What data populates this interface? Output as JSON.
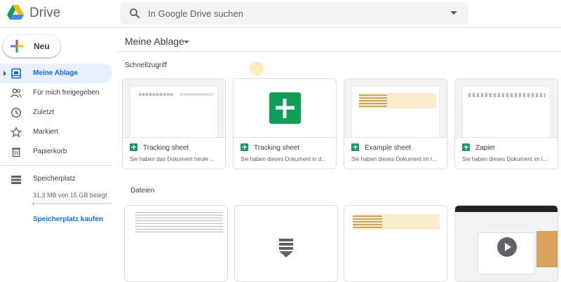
{
  "app": {
    "name": "Drive"
  },
  "search": {
    "placeholder": "In Google Drive suchen"
  },
  "new_button": {
    "label": "Neu"
  },
  "sidebar": {
    "items": [
      {
        "label": "Meine Ablage",
        "icon": "my-drive-icon",
        "active": true
      },
      {
        "label": "Für mich freigegeben",
        "icon": "shared-icon"
      },
      {
        "label": "Zuletzt",
        "icon": "clock-icon"
      },
      {
        "label": "Markiert",
        "icon": "star-icon"
      },
      {
        "label": "Papierkorb",
        "icon": "trash-icon"
      }
    ],
    "storage": {
      "title": "Speicherplatz",
      "used_text": "31,3 MB von 15 GB belegt",
      "used_fraction": 0.002,
      "buy_label": "Speicherplatz kaufen"
    }
  },
  "main": {
    "title": "Meine Ablage",
    "quick_access_label": "Schnellzugriff",
    "files_label": "Dateien",
    "quick_access": [
      {
        "name": "Tracking sheet",
        "subtitle": "Sie haben das Dokument heute ...",
        "icon": "sheets-icon"
      },
      {
        "name": "Tracking sheet",
        "subtitle": "Sie haben dieses Dokument in d...",
        "icon": "sheets-icon"
      },
      {
        "name": "Example sheet",
        "subtitle": "Sie haben dieses Dokument im l...",
        "icon": "sheets-icon"
      },
      {
        "name": "Zapier",
        "subtitle": "Sie haben dieses Dokument im l...",
        "icon": "sheets-icon"
      }
    ]
  },
  "colors": {
    "accent": "#1a73e8",
    "sheets_green": "#0f9d58",
    "active_bg": "#e8f0fe"
  }
}
